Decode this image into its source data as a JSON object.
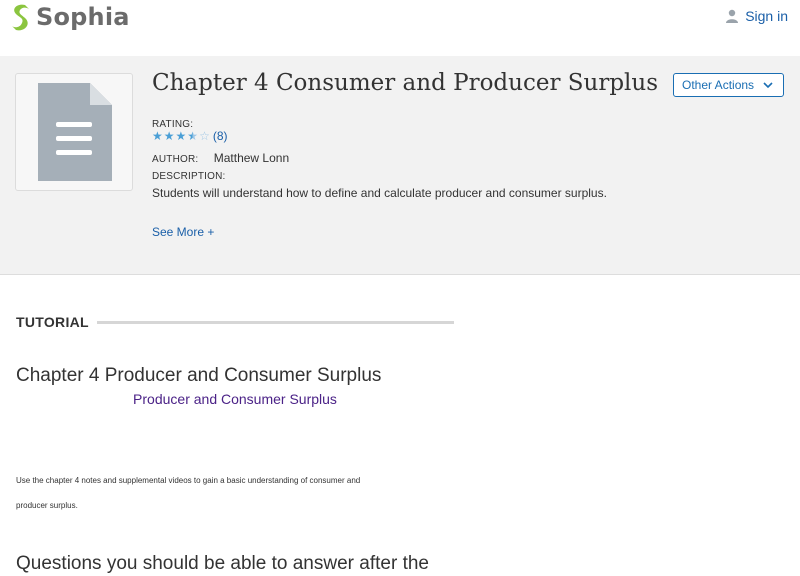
{
  "brand": {
    "name": "Sophia",
    "accent": "#8bc53f"
  },
  "nav": {
    "signin_label": "Sign in",
    "icon": "user-icon"
  },
  "resource": {
    "title": "Chapter 4 Consumer and Producer Surplus",
    "thumbnail_icon": "document-icon",
    "other_actions_label": "Other Actions",
    "rating_label": "RATING:",
    "rating_value": 3.5,
    "rating_max": 5,
    "rating_count": "(8)",
    "author_label": "AUTHOR:",
    "author_name": "Matthew Lonn",
    "description_label": "DESCRIPTION:",
    "description": "Students will understand how to define and calculate producer and consumer surplus.",
    "see_more_label": "See More +"
  },
  "tutorial": {
    "section_label": "TUTORIAL",
    "heading": "Chapter 4 Producer and Consumer Surplus",
    "subheading": "Producer and Consumer Surplus",
    "body_line1": "Use the chapter 4 notes and supplemental videos to gain a basic understanding of consumer and",
    "body_line2": "producer surplus.",
    "questions_heading": "Questions you should be able to answer after the"
  },
  "colors": {
    "link": "#1a5fa8",
    "subheading": "#4b2287",
    "band": "#f2f2f2"
  }
}
